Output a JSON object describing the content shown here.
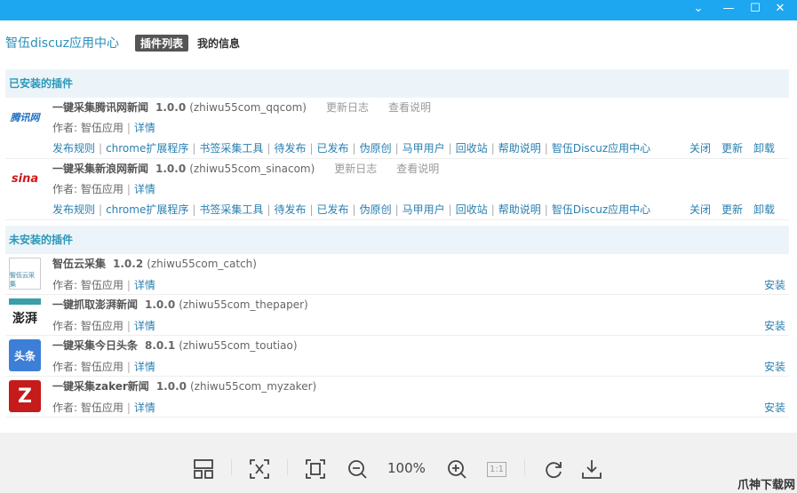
{
  "window": {
    "controls": [
      "chevron-down",
      "minimize",
      "maximize",
      "close"
    ]
  },
  "header": {
    "brand": "智伍discuz应用中心",
    "tabs": [
      {
        "label": "插件列表",
        "active": true
      },
      {
        "label": "我的信息",
        "active": false
      }
    ]
  },
  "installed": {
    "title": "已安装的插件",
    "author_label": "作者: 智伍应用",
    "detail": "详情",
    "changelog": "更新日志",
    "readme": "查看说明",
    "links": [
      "发布规则",
      "chrome扩展程序",
      "书签采集工具",
      "待发布",
      "已发布",
      "伪原创",
      "马甲用户",
      "回收站",
      "帮助说明",
      "智伍Discuz应用中心"
    ],
    "actions": [
      "关闭",
      "更新",
      "卸载"
    ],
    "items": [
      {
        "name": "一键采集腾讯网新闻",
        "version": "1.0.0",
        "id": "(zhiwu55com_qqcom)",
        "logo": "腾讯网"
      },
      {
        "name": "一键采集新浪网新闻",
        "version": "1.0.0",
        "id": "(zhiwu55com_sinacom)",
        "logo": "sina"
      }
    ]
  },
  "uninstalled": {
    "title": "未安装的插件",
    "install": "安装",
    "items": [
      {
        "name": "智伍云采集",
        "version": "1.0.2",
        "id": "(zhiwu55com_catch)",
        "logo": "智伍云采集"
      },
      {
        "name": "一键抓取澎湃新闻",
        "version": "1.0.0",
        "id": "(zhiwu55com_thepaper)",
        "logo": "澎湃"
      },
      {
        "name": "一键采集今日头条",
        "version": "8.0.1",
        "id": "(zhiwu55com_toutiao)",
        "logo": "头条"
      },
      {
        "name": "一键采集zaker新闻",
        "version": "1.0.0",
        "id": "(zhiwu55com_myzaker)",
        "logo": "Z"
      }
    ]
  },
  "viewer": {
    "zoom": "100%",
    "one_to_one": "1:1"
  },
  "watermark": "爪神下载网"
}
